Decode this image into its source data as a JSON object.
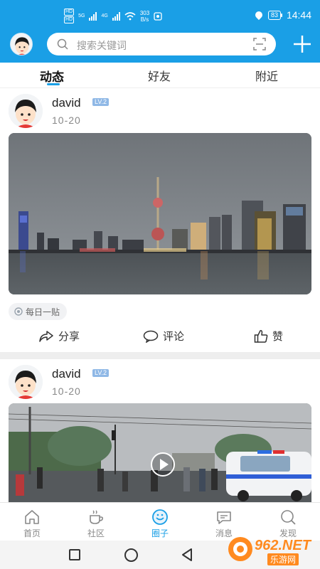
{
  "status_bar": {
    "sim_tags": [
      "HD",
      "HD"
    ],
    "network_1": "5G",
    "network_2": "4G",
    "speed_value": "303",
    "speed_unit": "B/s",
    "battery": "83",
    "time": "14:44"
  },
  "header": {
    "search_placeholder": "搜索关键词"
  },
  "tabs": [
    {
      "label": "动态",
      "active": true
    },
    {
      "label": "好友",
      "active": false
    },
    {
      "label": "附近",
      "active": false
    }
  ],
  "posts": [
    {
      "user": "david",
      "level": "LV.2",
      "date": "10-20",
      "topic": "每日一贴",
      "actions": {
        "share": "分享",
        "comment": "评论",
        "like": "赞"
      },
      "media": "city-skyline-photo"
    },
    {
      "user": "david",
      "level": "LV.2",
      "date": "10-20",
      "media": "street-video"
    }
  ],
  "bottom_nav": [
    {
      "label": "首页",
      "icon": "home-icon",
      "active": false
    },
    {
      "label": "社区",
      "icon": "coffee-cup-icon",
      "active": false
    },
    {
      "label": "圈子",
      "icon": "circle-smile-icon",
      "active": true
    },
    {
      "label": "消息",
      "icon": "chat-bubble-icon",
      "active": false
    },
    {
      "label": "发现",
      "icon": "discover-search-icon",
      "active": false
    }
  ],
  "watermark": {
    "brand": "962.NET",
    "sub": "乐游网"
  },
  "colors": {
    "accent": "#1a9fe6",
    "badge": "#8fb8e6",
    "divider": "#eeeeee"
  }
}
